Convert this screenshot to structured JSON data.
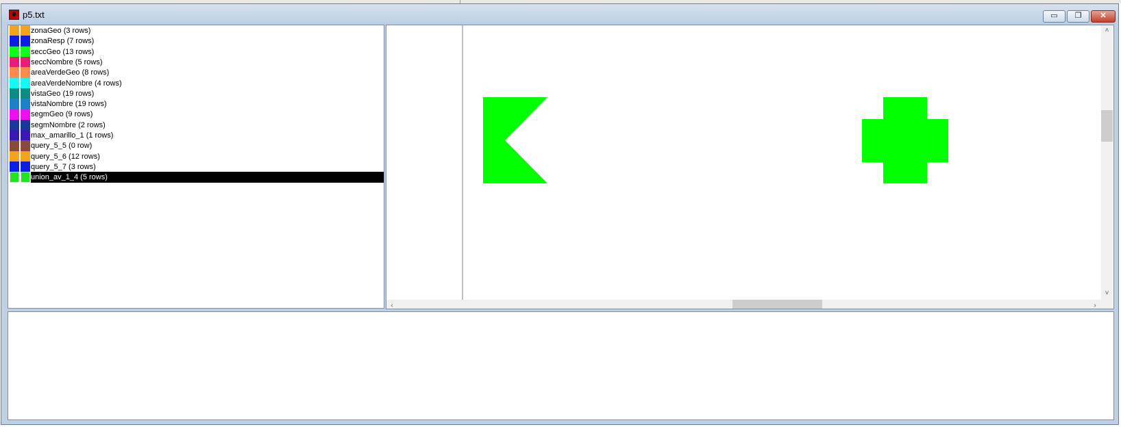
{
  "window": {
    "title": "p5.txt",
    "controls": {
      "minimize_glyph": "▭",
      "maximize_glyph": "❐",
      "close_glyph": "✕"
    }
  },
  "layers": [
    {
      "label": "zonaGeo (3 rows)",
      "color": "#f5a21b",
      "selected": false
    },
    {
      "label": "zonaResp (7 rows)",
      "color": "#0a1ee6",
      "selected": false
    },
    {
      "label": "seccGeo (13 rows)",
      "color": "#0dff1a",
      "selected": false
    },
    {
      "label": "seccNombre (5 rows)",
      "color": "#ef1a78",
      "selected": false
    },
    {
      "label": "areaVerdeGeo (8 rows)",
      "color": "#ff8a4c",
      "selected": false
    },
    {
      "label": "areaVerdeNombre (4 rows)",
      "color": "#12fbfb",
      "selected": false
    },
    {
      "label": "vistaGeo (19 rows)",
      "color": "#0a8b84",
      "selected": false
    },
    {
      "label": "vistaNombre (19 rows)",
      "color": "#1b82c8",
      "selected": false
    },
    {
      "label": "segmGeo (9 rows)",
      "color": "#f00ef0",
      "selected": false
    },
    {
      "label": "segmNombre (2 rows)",
      "color": "#173a9a",
      "selected": false
    },
    {
      "label": "max_amarillo_1 (1 rows)",
      "color": "#3a18b8",
      "selected": false
    },
    {
      "label": "query_5_5 (0 row)",
      "color": "#8a4a3a",
      "selected": false
    },
    {
      "label": "query_5_6 (12 rows)",
      "color": "#f5a21b",
      "selected": false
    },
    {
      "label": "query_5_7 (3 rows)",
      "color": "#0a1ee6",
      "selected": false
    },
    {
      "label": "union_av_1_4 (5 rows)",
      "color": "#1ee61e",
      "selected": true
    }
  ],
  "map": {
    "shape_color": "#00ff00",
    "axis_color": "#808080"
  },
  "scrollbars": {
    "up_arrow": "˄",
    "down_arrow": "˅",
    "left_arrow": "‹",
    "right_arrow": "›"
  }
}
